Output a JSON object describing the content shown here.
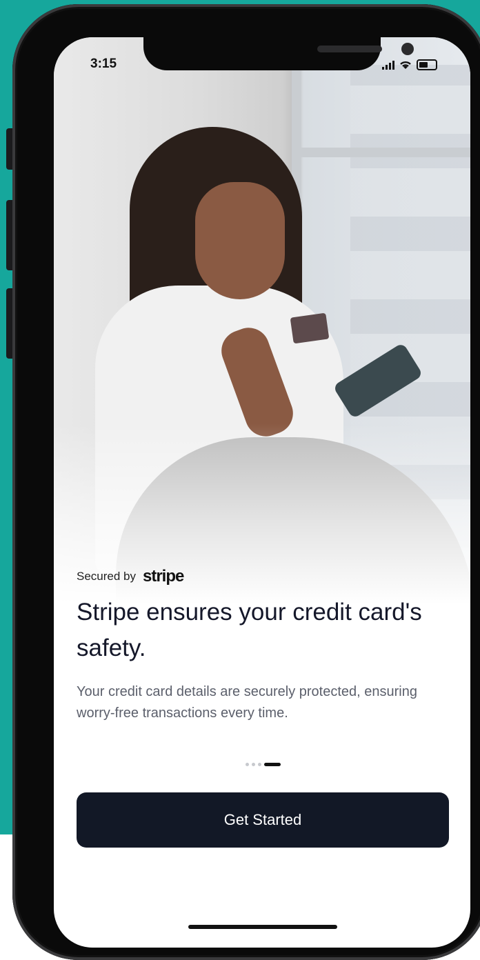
{
  "status_bar": {
    "time": "3:15",
    "icons": [
      "signal-icon",
      "wifi-icon",
      "battery-icon"
    ]
  },
  "brand": {
    "secured_prefix": "Secured by",
    "logo_text": "stripe"
  },
  "onboarding": {
    "title": "Stripe ensures your credit card's safety.",
    "description": "Your credit card details are securely protected, ensuring worry-free transactions every time.",
    "pager": {
      "pages": 4,
      "active_index": 3
    }
  },
  "cta": {
    "label": "Get Started"
  },
  "colors": {
    "background": "#16a79c",
    "button": "#121826",
    "title": "#15182a",
    "body_text": "#5b5f6b"
  }
}
